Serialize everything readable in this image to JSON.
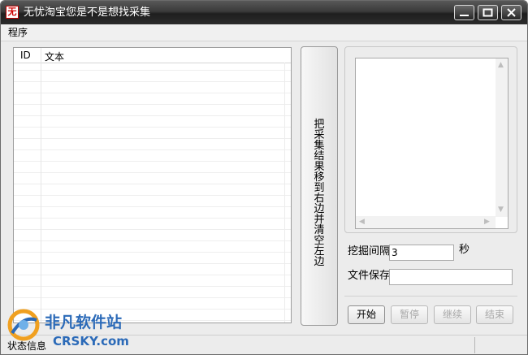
{
  "window": {
    "title": "无忧淘宝您是不是想找采集",
    "icon_glyph": "无"
  },
  "menu": {
    "items": [
      "程序"
    ]
  },
  "list": {
    "columns": [
      "ID",
      "文本"
    ]
  },
  "move_button": {
    "label": "把采集结果移到右边并清空左边"
  },
  "settings": {
    "interval_label": "挖掘间隔",
    "interval_value": "3",
    "interval_unit": "秒",
    "save_label": "文件保存",
    "save_value": ""
  },
  "actions": {
    "start": "开始",
    "pause": "暂停",
    "resume": "继续",
    "end": "结束"
  },
  "status": {
    "text": "状态信息"
  },
  "watermark": {
    "cn": "非凡软件站",
    "en": "CRSKY.com"
  },
  "colors": {
    "titlebar": "#2c2c2c",
    "watermark": "#2b6ab8"
  }
}
